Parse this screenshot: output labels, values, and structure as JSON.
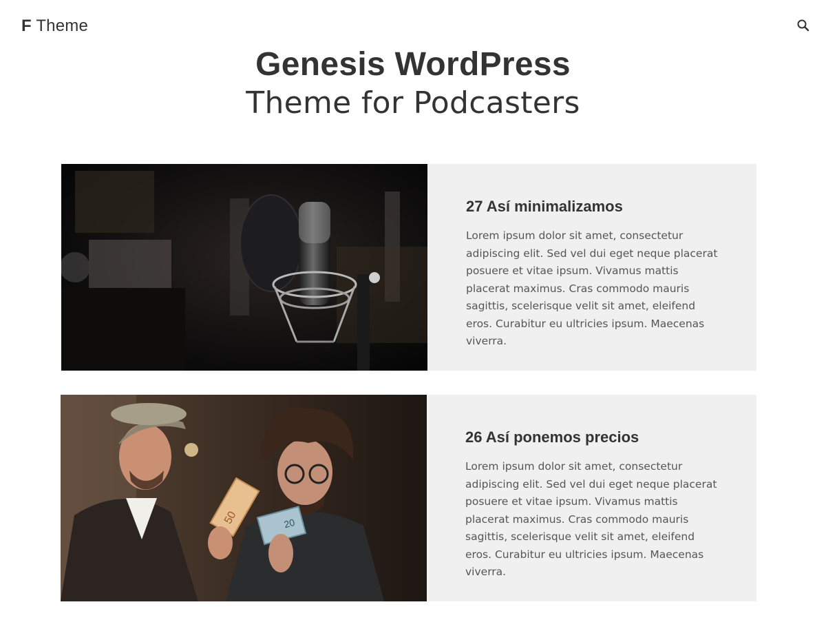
{
  "header": {
    "logo_mark": "F",
    "logo_text": "Theme",
    "search_icon": "search-icon"
  },
  "hero": {
    "line1": "Genesis WordPress",
    "line2": "Theme for Podcasters"
  },
  "episodes": [
    {
      "title": "27 Así minimalizamos",
      "excerpt": "Lorem ipsum dolor sit amet, consectetur adipiscing elit. Sed vel dui eget neque placerat posuere et vitae ipsum. Vivamus mattis placerat maximus. Cras commodo mauris sagittis, scelerisque velit sit amet, eleifend eros. Curabitur eu ultricies ipsum. Maecenas viverra.",
      "image": "studio-microphone-photo"
    },
    {
      "title": "26 Así ponemos precios",
      "excerpt": "Lorem ipsum dolor sit amet, consectetur adipiscing elit. Sed vel dui eget neque placerat posuere et vitae ipsum. Vivamus mattis placerat maximus. Cras commodo mauris sagittis, scelerisque velit sit amet, eleifend eros. Curabitur eu ultricies ipsum. Maecenas viverra.",
      "image": "two-hosts-with-euro-notes-photo"
    }
  ],
  "colors": {
    "text": "#333333",
    "excerpt": "#555555",
    "card_bg": "#f0f0f0",
    "page_bg": "#ffffff"
  }
}
